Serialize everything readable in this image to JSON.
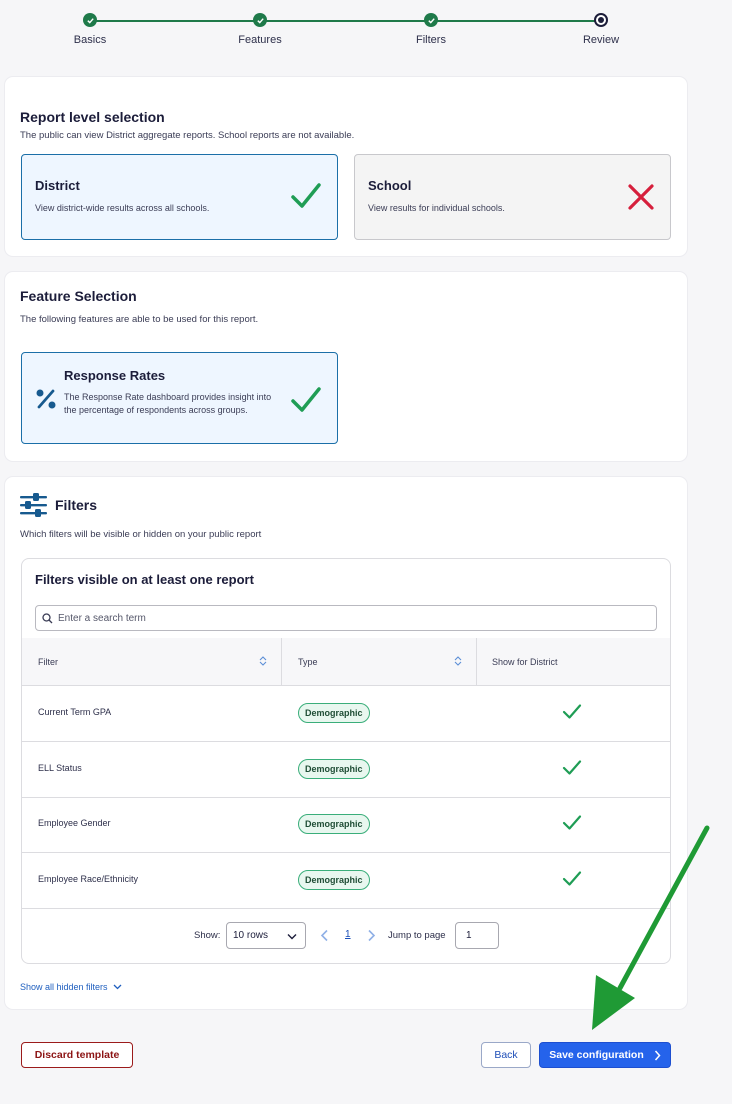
{
  "stepper": {
    "steps": [
      {
        "label": "Basics",
        "state": "done"
      },
      {
        "label": "Features",
        "state": "done"
      },
      {
        "label": "Filters",
        "state": "done"
      },
      {
        "label": "Review",
        "state": "current"
      }
    ]
  },
  "report_level": {
    "title": "Report level selection",
    "description": "The public can view District aggregate reports. School reports are not available.",
    "options": [
      {
        "title": "District",
        "description": "View district-wide results across all schools.",
        "selected": true,
        "mark": "check-icon"
      },
      {
        "title": "School",
        "description": "View results for individual schools.",
        "selected": false,
        "mark": "x-icon"
      }
    ]
  },
  "feature_selection": {
    "title": "Feature Selection",
    "description": "The following features are able to be used for this report.",
    "features": [
      {
        "title": "Response Rates",
        "description": "The Response Rate dashboard provides insight into the percentage of respondents across groups.",
        "icon": "percent-icon",
        "selected": true
      }
    ]
  },
  "filters": {
    "title": "Filters",
    "description": "Which filters will be visible or hidden on your public report",
    "table_title": "Filters visible on at least one report",
    "search_placeholder": "Enter a search term",
    "columns": [
      "Filter",
      "Type",
      "Show for District"
    ],
    "rows": [
      {
        "filter": "Current Term GPA",
        "type": "Demographic",
        "show": true
      },
      {
        "filter": "ELL Status",
        "type": "Demographic",
        "show": true
      },
      {
        "filter": "Employee Gender",
        "type": "Demographic",
        "show": true
      },
      {
        "filter": "Employee Race/Ethnicity",
        "type": "Demographic",
        "show": true
      }
    ],
    "pagination": {
      "show_label": "Show:",
      "rows_option": "10 rows",
      "current_page": "1",
      "jump_label": "Jump to page",
      "jump_value": "1"
    },
    "show_hidden_link": "Show all hidden filters"
  },
  "actions": {
    "discard": "Discard template",
    "back": "Back",
    "save": "Save configuration"
  },
  "colors": {
    "primary": "#2563eb",
    "success": "#1f9d55",
    "danger": "#d61f3c",
    "annotation_arrow": "#1f9a35"
  }
}
